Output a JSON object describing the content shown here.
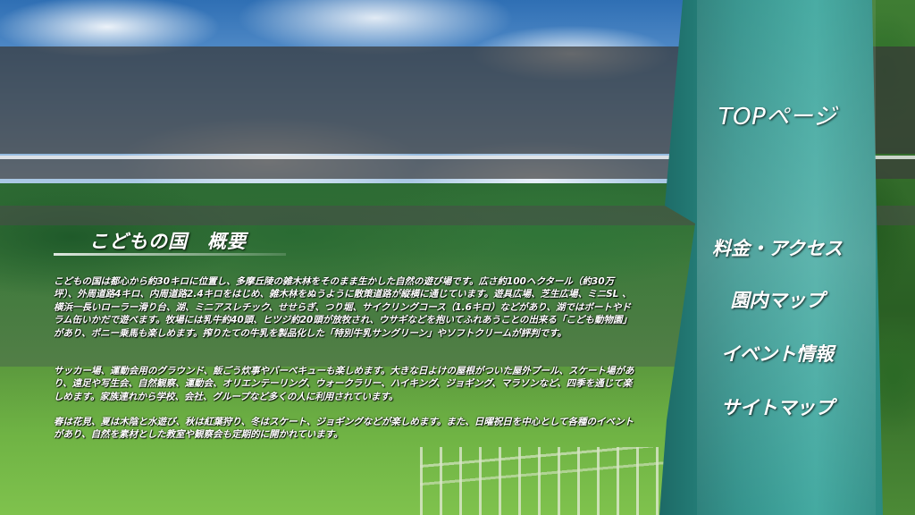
{
  "header": {
    "section_title": "こどもの国　概要"
  },
  "content": {
    "paragraphs": [
      "こどもの国は都心から約30キロに位置し、多摩丘陵の雑木林をそのまま生かした自然の遊び場です。広さ約100ヘクタール（約30万坪）、外周道路4キロ、内周道路2.4キロをはじめ、雑木林をぬうように散策道路が縦横に通じています。遊具広場、芝生広場、ミニSL 、横浜一長いローラー滑り台、湖、ミニアスレチック、せせらぎ、つり堀、サイクリングコース（1.6キロ）などがあり、湖ではボートやドラム缶いかだで遊べます。牧場には乳牛約40頭、ヒツジ約20頭が放牧され、ウサギなどを抱いてふれあうことの出来る「こども動物園」があり、ポニー乗馬も楽しめます。搾りたての牛乳を製品化した「特別牛乳サングリーン」やソフトクリームが評判です。",
      "サッカー場、運動会用のグラウンド、飯ごう炊事やバーベキューも楽しめます。大きな日よけの屋根がついた屋外プール、スケート場があり、遠足や写生会、自然観察、運動会、オリエンテーリング、ウォークラリー、ハイキング、ジョギング、マラソンなど、四季を通じて楽しめます。家族連れから学校、会社、グループなど多くの人に利用されています。",
      "春は花見、夏は木陰と水遊び、秋は紅葉狩り、冬はスケート、ジョギングなどが楽しめます。また、日曜祝日を中心として各種のイベントがあり、自然を素材とした教室や観察会も定期的に開かれています。"
    ]
  },
  "nav": {
    "items": [
      {
        "label": "TOPページ"
      },
      {
        "label": "料金・アクセス"
      },
      {
        "label": "園内マップ"
      },
      {
        "label": "イベント情報"
      },
      {
        "label": "サイトマップ"
      }
    ]
  },
  "colors": {
    "nav_panel": "#2a8d86",
    "overlay_band": "#373737",
    "text": "#ffffff"
  }
}
